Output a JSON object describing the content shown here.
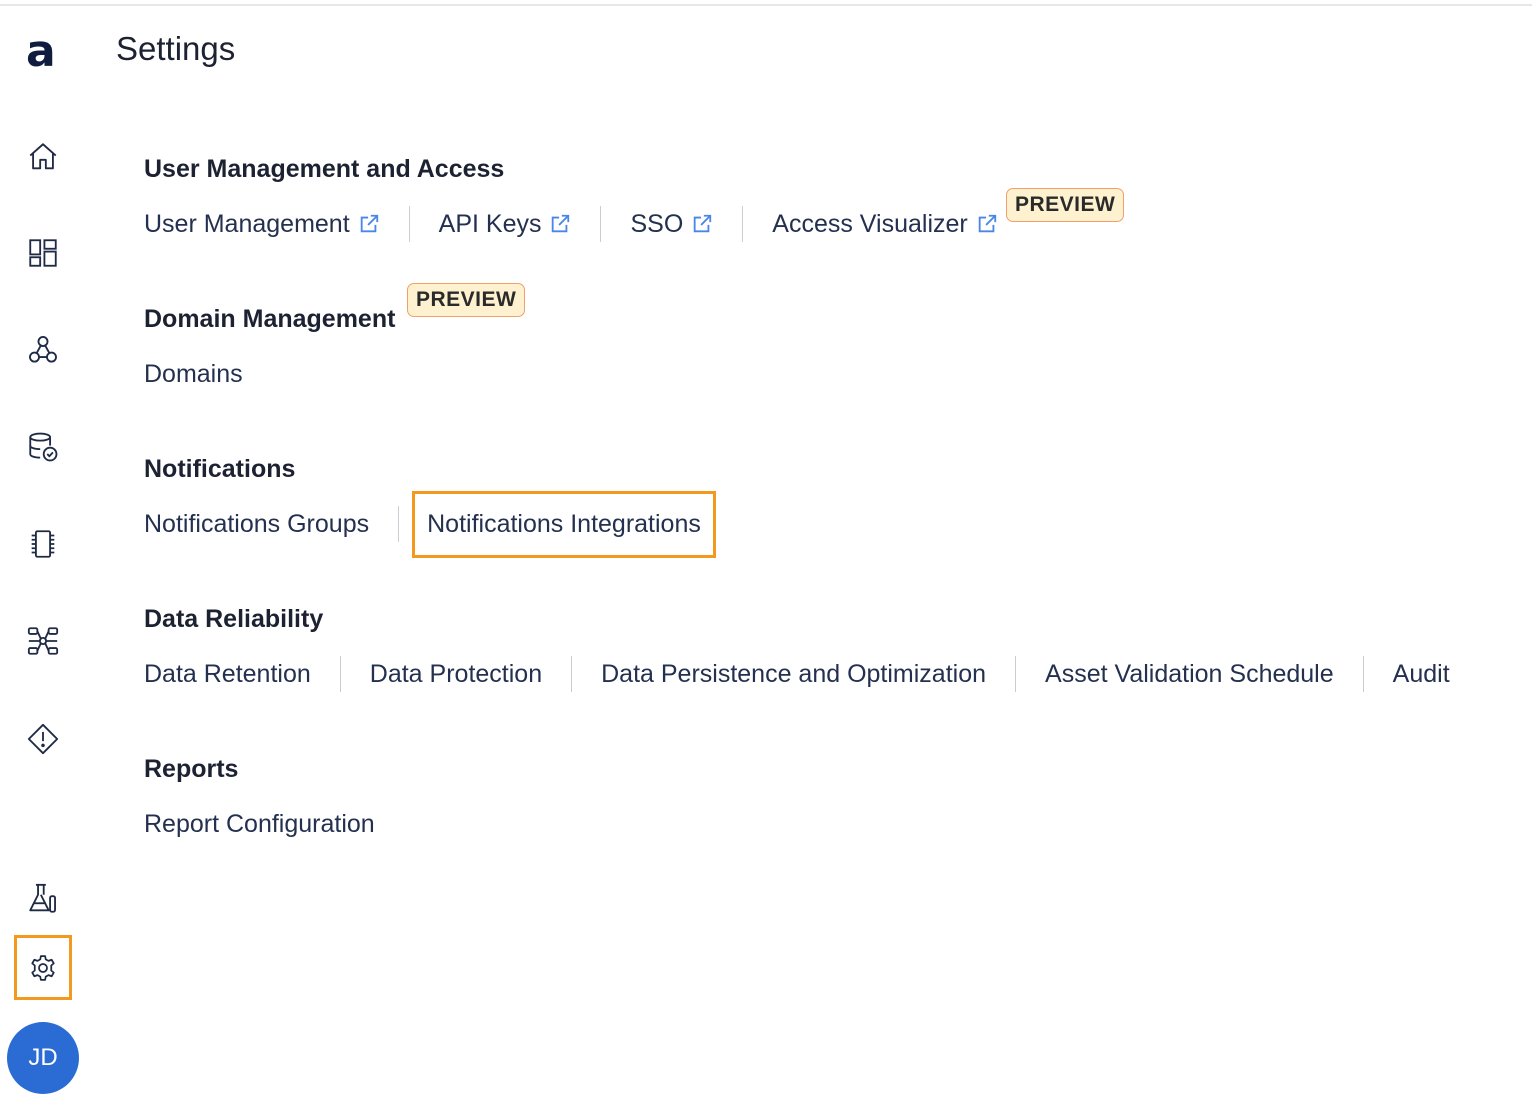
{
  "app": {
    "logo_text": "a",
    "page_title": "Settings"
  },
  "sidebar": {
    "items": [
      {
        "icon": "home-icon"
      },
      {
        "icon": "dashboard-icon"
      },
      {
        "icon": "network-icon"
      },
      {
        "icon": "database-check-icon"
      },
      {
        "icon": "chip-icon"
      },
      {
        "icon": "pipeline-icon"
      },
      {
        "icon": "alert-diamond-icon"
      },
      {
        "icon": "flask-icon"
      },
      {
        "icon": "gear-icon",
        "active": true
      }
    ],
    "avatar_initials": "JD"
  },
  "sections": {
    "user_management": {
      "title": "User Management and Access",
      "links": {
        "user_management": "User Management",
        "api_keys": "API Keys",
        "sso": "SSO",
        "access_visualizer": "Access Visualizer"
      },
      "access_visualizer_badge": "PREVIEW"
    },
    "domain_management": {
      "title": "Domain Management",
      "badge": "PREVIEW",
      "links": {
        "domains": "Domains"
      }
    },
    "notifications": {
      "title": "Notifications",
      "links": {
        "groups": "Notifications Groups",
        "integrations": "Notifications Integrations"
      }
    },
    "data_reliability": {
      "title": "Data Reliability",
      "links": {
        "retention": "Data Retention",
        "protection": "Data Protection",
        "persistence": "Data Persistence and Optimization",
        "asset_validation": "Asset Validation Schedule",
        "audit": "Audit"
      }
    },
    "reports": {
      "title": "Reports",
      "links": {
        "report_configuration": "Report Configuration"
      }
    }
  },
  "colors": {
    "highlight": "#f39a1e",
    "link_icon": "#4a86e8",
    "badge_bg": "#fdf1cf",
    "avatar_bg": "#2b6cd4",
    "logo": "#0f1c3f"
  }
}
